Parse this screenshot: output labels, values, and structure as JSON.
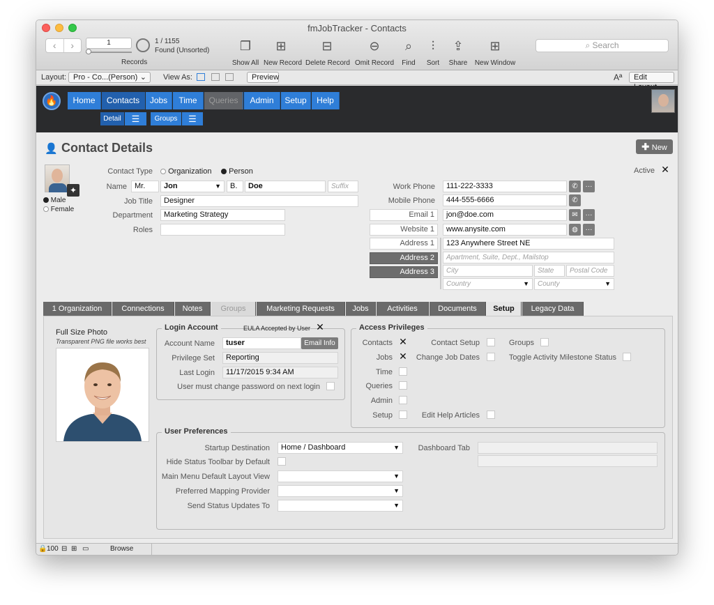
{
  "window": {
    "title": "fmJobTracker - Contacts"
  },
  "toolbar": {
    "record_value": "1",
    "record_count": "1 / 1155",
    "found_status": "Found (Unsorted)",
    "records_label": "Records",
    "buttons": [
      {
        "label": "Show All",
        "icon": "show-all-icon"
      },
      {
        "label": "New Record",
        "icon": "plus-box-icon"
      },
      {
        "label": "Delete Record",
        "icon": "minus-box-icon"
      },
      {
        "label": "Omit Record",
        "icon": "omit-icon"
      },
      {
        "label": "Find",
        "icon": "magnifier-icon"
      },
      {
        "label": "Sort",
        "icon": "sort-bars-icon"
      },
      {
        "label": "Share",
        "icon": "share-icon"
      },
      {
        "label": "New Window",
        "icon": "new-window-icon"
      }
    ],
    "search_placeholder": "Search"
  },
  "layoutbar": {
    "layout_label": "Layout:",
    "layout_value": "Pro - Co...(Person)",
    "view_as_label": "View As:",
    "preview_label": "Preview",
    "font_size_label": "Aª",
    "edit_layout_label": "Edit Layout"
  },
  "nav": {
    "tabs": [
      "Home",
      "Contacts",
      "Jobs",
      "Time",
      "Queries",
      "Admin",
      "Setup",
      "Help"
    ],
    "active": "Contacts",
    "disabled": "Queries",
    "sub_tabs": [
      "Detail",
      "Groups"
    ]
  },
  "header": {
    "title": "Contact Details",
    "new_button": "New"
  },
  "contact": {
    "type_label": "Contact Type",
    "type_options": [
      "Organization",
      "Person"
    ],
    "type_selected": "Person",
    "gender_options": [
      "Male",
      "Female"
    ],
    "gender_selected": "Male",
    "active_label": "Active",
    "active_mark": "✕",
    "name_label": "Name",
    "prefix": "Mr.",
    "first": "Jon",
    "middle": "B.",
    "last": "Doe",
    "suffix_placeholder": "Suffix",
    "job_title_label": "Job Title",
    "job_title": "Designer",
    "department_label": "Department",
    "department": "Marketing Strategy",
    "roles_label": "Roles",
    "roles": "",
    "work_phone_label": "Work Phone",
    "work_phone": "111-222-3333",
    "mobile_phone_label": "Mobile Phone",
    "mobile_phone": "444-555-6666",
    "email_label": "Email 1",
    "email": "jon@doe.com",
    "website_label": "Website 1",
    "website": "www.anysite.com",
    "address1_label": "Address 1",
    "address2_label": "Address 2",
    "address3_label": "Address 3",
    "address_street": "123 Anywhere Street NE",
    "address_apt_placeholder": "Apartment, Suite, Dept., Mailstop",
    "city_placeholder": "City",
    "state_placeholder": "State",
    "postal_placeholder": "Postal Code",
    "country_placeholder": "Country",
    "county_placeholder": "County"
  },
  "tabs": [
    "1 Organization",
    "Connections",
    "Notes",
    "Groups",
    "Marketing Requests",
    "Jobs",
    "Activities",
    "Documents",
    "Setup",
    "Legacy Data"
  ],
  "tabs_active": "Setup",
  "tabs_disabled": "Groups",
  "photo": {
    "title": "Full Size Photo",
    "subtitle": "Transparent PNG file works best"
  },
  "login": {
    "group_title": "Login Account",
    "eula_label": "EULA Accepted by User",
    "eula_mark": "✕",
    "account_name_label": "Account Name",
    "account_name": "tuser",
    "email_info_button": "Email Info",
    "privilege_set_label": "Privilege Set",
    "privilege_set": "Reporting",
    "last_login_label": "Last Login",
    "last_login": "11/17/2015 9:34 AM",
    "change_password_label": "User must change password on next login"
  },
  "access": {
    "group_title": "Access Privileges",
    "items": [
      {
        "label": "Contacts",
        "checked": "✕"
      },
      {
        "label": "Jobs",
        "checked": "✕"
      },
      {
        "label": "Time",
        "checked": ""
      },
      {
        "label": "Queries",
        "checked": ""
      },
      {
        "label": "Admin",
        "checked": ""
      },
      {
        "label": "Setup",
        "checked": ""
      }
    ],
    "middle_items": [
      "Contact Setup",
      "Change Job Dates",
      "Edit Help Articles"
    ],
    "right_items": [
      "Groups",
      "Toggle Activity Milestone Status"
    ]
  },
  "prefs": {
    "group_title": "User Preferences",
    "startup_label": "Startup Destination",
    "startup_value": "Home / Dashboard",
    "dashboard_tab_label": "Dashboard Tab",
    "hide_status_label": "Hide Status Toolbar by Default",
    "main_menu_label": "Main Menu Default Layout View",
    "mapping_label": "Preferred Mapping Provider",
    "status_updates_label": "Send Status Updates To"
  },
  "status": {
    "zoom": "100",
    "mode": "Browse"
  },
  "colors": {
    "nav_blue": "#2f7ed8",
    "nav_active": "#2260ad",
    "dark_header": "#2a2b2d"
  }
}
